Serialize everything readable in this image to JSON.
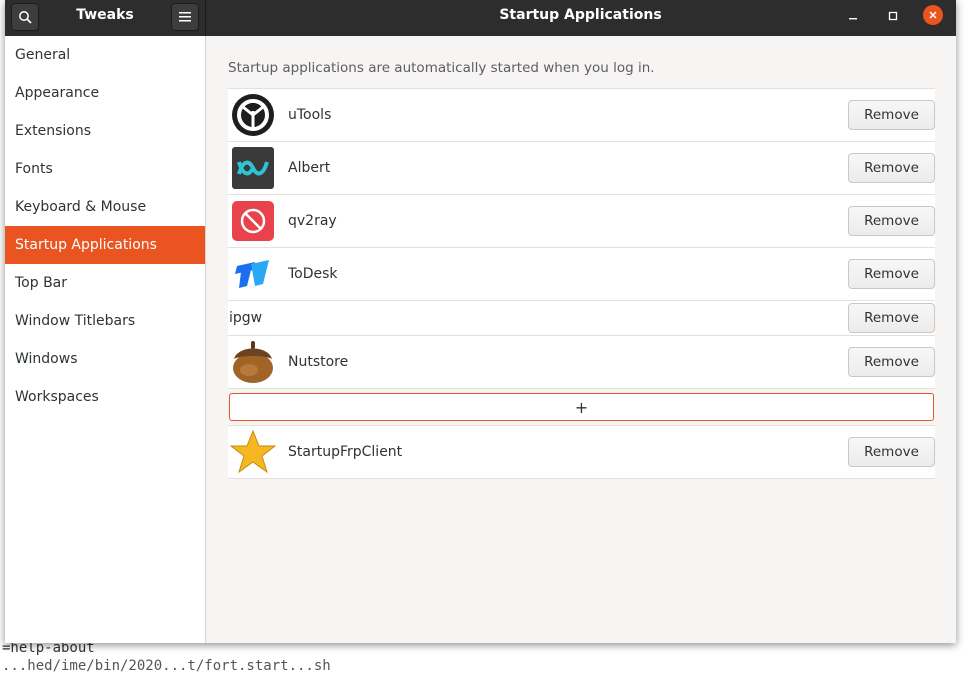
{
  "background_terminal": {
    "help_about": "=help-about",
    "bottom_line": "...hed/ime/bin/2020...t/fort.start...sh"
  },
  "header": {
    "sidebar_title": "Tweaks",
    "main_title": "Startup Applications",
    "search_icon": "search-icon",
    "menu_icon": "hamburger-menu-icon"
  },
  "sidebar": {
    "items": [
      {
        "label": "General"
      },
      {
        "label": "Appearance"
      },
      {
        "label": "Extensions"
      },
      {
        "label": "Fonts"
      },
      {
        "label": "Keyboard & Mouse"
      },
      {
        "label": "Startup Applications",
        "active": true
      },
      {
        "label": "Top Bar"
      },
      {
        "label": "Window Titlebars"
      },
      {
        "label": "Windows"
      },
      {
        "label": "Workspaces"
      }
    ]
  },
  "main": {
    "description": "Startup applications are automatically started when you log in.",
    "apps": [
      {
        "name": "uTools",
        "icon": "utools-icon",
        "remove_label": "Remove"
      },
      {
        "name": "Albert",
        "icon": "albert-icon",
        "remove_label": "Remove"
      },
      {
        "name": "qv2ray",
        "icon": "qv2ray-icon",
        "remove_label": "Remove"
      },
      {
        "name": "ToDesk",
        "icon": "todesk-icon",
        "remove_label": "Remove"
      },
      {
        "name": "ipgw",
        "icon": "",
        "remove_label": "Remove"
      },
      {
        "name": "Nutstore",
        "icon": "nutstore-icon",
        "remove_label": "Remove"
      }
    ],
    "add_label": "+",
    "after_add_apps": [
      {
        "name": "StartupFrpClient",
        "icon": "star-icon",
        "remove_label": "Remove"
      }
    ]
  },
  "colors": {
    "accent": "#e95420",
    "headerbar": "#2d2d2d",
    "content_bg": "#f6f5f4"
  }
}
